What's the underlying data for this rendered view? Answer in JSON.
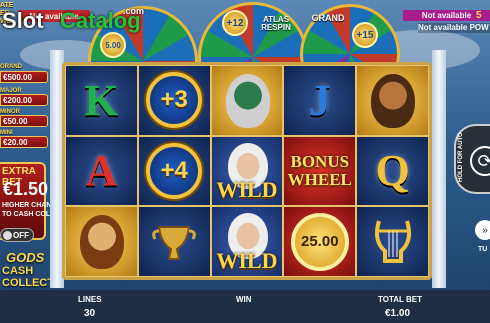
{
  "logo": {
    "slot": "Slot",
    "catalog": "Catalog",
    "com": ".com"
  },
  "top_left": {
    "not_available": "Not available",
    "ate_text": "ATE\nER\nWE"
  },
  "wheels": {
    "left": {
      "value_coin": "5.00"
    },
    "middle": {
      "coin": "+12",
      "label_line1": "ATLAS",
      "label_line2": "RESPIN"
    },
    "right": {
      "label": "GRAND",
      "coin": "+15"
    }
  },
  "top_right": {
    "not_available": "Not available",
    "not_available_2": "Not available POW",
    "corner_value": "5"
  },
  "jackpots": [
    {
      "name": "GRAND",
      "value": "€500.00"
    },
    {
      "name": "MAJOR",
      "value": "€200.00"
    },
    {
      "name": "MINOR",
      "value": "€50.00"
    },
    {
      "name": "MINI",
      "value": "€20.00"
    }
  ],
  "extra_bet": {
    "title": "EXTRA BET",
    "value": "€1.50",
    "line1": "HIGHER CHANCE",
    "line2": "TO CASH COLLECT",
    "toggle": "OFF"
  },
  "game_logo": {
    "line1": "GODS",
    "line2": "CASH COLLECT"
  },
  "reels": [
    [
      {
        "type": "letter",
        "text": "K",
        "color": "#1fb14c"
      },
      {
        "type": "coin",
        "text": "+3"
      },
      {
        "type": "god",
        "name": "poseidon"
      },
      {
        "type": "letter",
        "text": "J",
        "color": "#2a7be0"
      },
      {
        "type": "god",
        "name": "hercules"
      }
    ],
    [
      {
        "type": "letter",
        "text": "A",
        "color": "#e0302a"
      },
      {
        "type": "coin",
        "text": "+4"
      },
      {
        "type": "wild",
        "text": "WILD"
      },
      {
        "type": "bonus",
        "text1": "BONUS",
        "text2": "WHEEL"
      },
      {
        "type": "letter",
        "text": "Q",
        "color": "#f2c23c"
      }
    ],
    [
      {
        "type": "god",
        "name": "athena"
      },
      {
        "type": "urn"
      },
      {
        "type": "wild",
        "text": "WILD"
      },
      {
        "type": "goldcoin",
        "text": "25.00"
      },
      {
        "type": "lyre"
      }
    ]
  ],
  "controls": {
    "hold_label": "HOLD FOR AUTO",
    "turbo_label": "TU"
  },
  "bottom_bar": {
    "lines_label": "LINES",
    "lines_value": "30",
    "win_label": "WIN",
    "total_bet_label": "TOTAL BET",
    "total_bet_value": "€1.00"
  }
}
